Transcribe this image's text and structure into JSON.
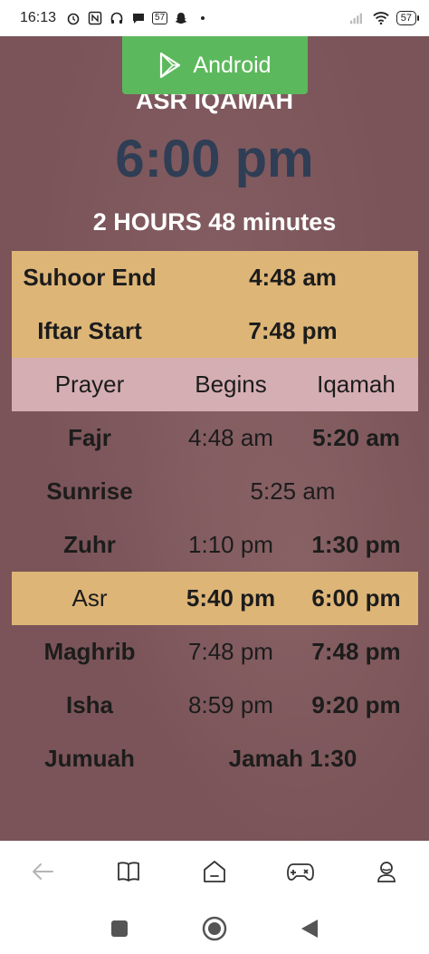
{
  "status_bar": {
    "time": "16:13",
    "badge_left": "57",
    "battery": "57"
  },
  "banner": {
    "label": "Android"
  },
  "hero": {
    "label": "ASR IQAMAH",
    "time": "6:00 pm",
    "countdown": "2 HOURS 48 minutes"
  },
  "fasting": [
    {
      "label": "Suhoor End",
      "time": "4:48 am"
    },
    {
      "label": "Iftar Start",
      "time": "7:48 pm"
    }
  ],
  "header": {
    "prayer": "Prayer",
    "begins": "Begins",
    "iqamah": "Iqamah"
  },
  "prayers": [
    {
      "name": "Fajr",
      "begins": "4:48 am",
      "iqamah": "5:20 am"
    },
    {
      "name": "Sunrise",
      "begins": "5:25 am"
    },
    {
      "name": "Zuhr",
      "begins": "1:10 pm",
      "iqamah": "1:30 pm"
    },
    {
      "name": "Asr",
      "begins": "5:40 pm",
      "iqamah": "6:00 pm"
    },
    {
      "name": "Maghrib",
      "begins": "7:48 pm",
      "iqamah": "7:48 pm"
    },
    {
      "name": "Isha",
      "begins": "8:59 pm",
      "iqamah": "9:20 pm"
    },
    {
      "name": "Jumuah",
      "begins": "Jamah 1:30"
    }
  ],
  "colors": {
    "background": "#7a5458",
    "highlight_row": "#ddb577",
    "header_row": "#d5aeb3",
    "android_button": "#5cb85c",
    "hero_time": "#2f3e55"
  },
  "icons": {
    "bottom_nav": [
      "back-arrow-icon",
      "book-icon",
      "home-icon",
      "gamepad-icon",
      "profile-icon"
    ],
    "system_nav": [
      "recents-icon",
      "home-circle-icon",
      "back-triangle-icon"
    ]
  }
}
